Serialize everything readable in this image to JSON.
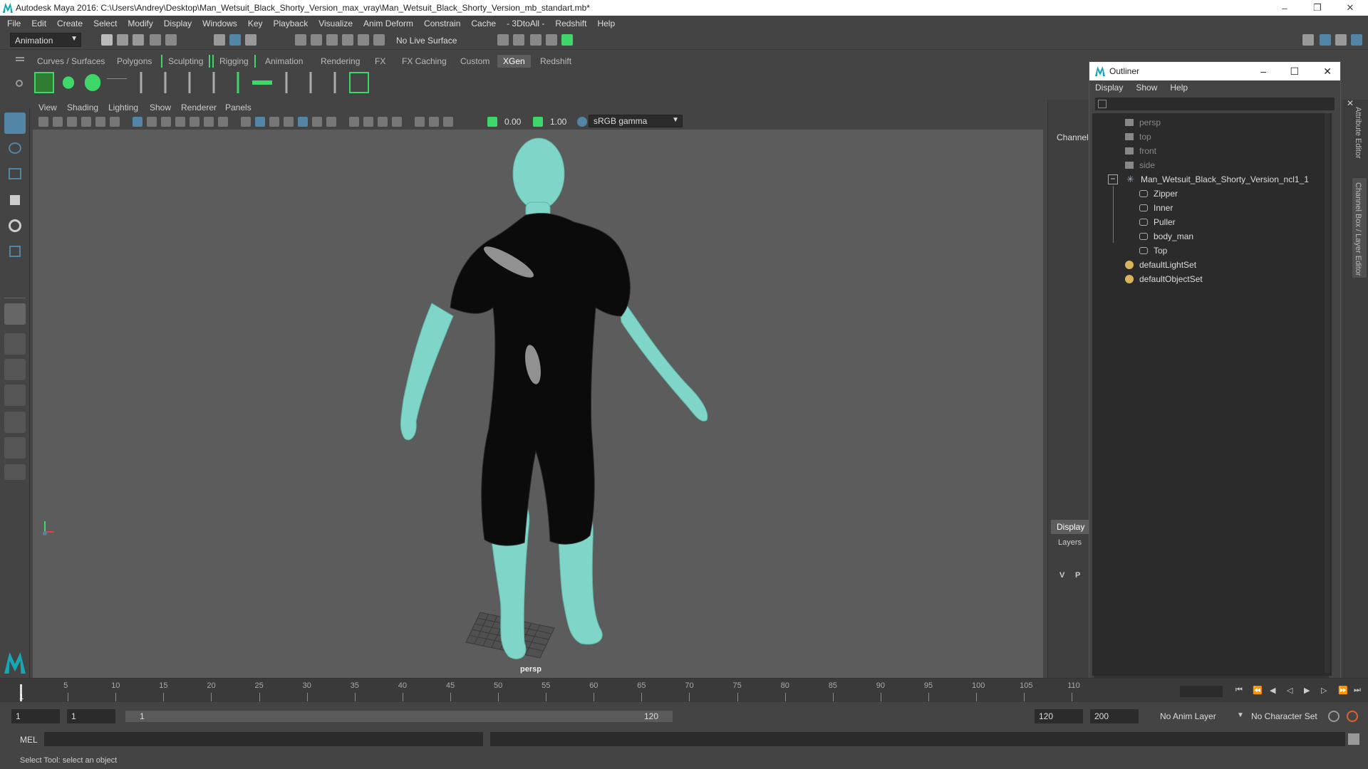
{
  "window": {
    "title": "Autodesk Maya 2016: C:\\Users\\Andrey\\Desktop\\Man_Wetsuit_Black_Shorty_Version_max_vray\\Man_Wetsuit_Black_Shorty_Version_mb_standart.mb*",
    "minimize": "–",
    "restore": "❐",
    "close": "✕"
  },
  "menubar": [
    "File",
    "Edit",
    "Create",
    "Select",
    "Modify",
    "Display",
    "Windows",
    "Key",
    "Playback",
    "Visualize",
    "Anim Deform",
    "Constrain",
    "Cache",
    "- 3DtoAll -",
    "Redshift",
    "Help"
  ],
  "statusline": {
    "menuset": "Animation",
    "live_surface": "No Live Surface"
  },
  "shelf_tabs": [
    "Curves / Surfaces",
    "Polygons",
    "Sculpting",
    "Rigging",
    "Animation",
    "Rendering",
    "FX",
    "FX Caching",
    "Custom",
    "XGen",
    "Redshift"
  ],
  "shelf_active_tab": "XGen",
  "viewport": {
    "menu": [
      "View",
      "Shading",
      "Lighting",
      "Show",
      "Renderer",
      "Panels"
    ],
    "exposure": "0.00",
    "gamma": "1.00",
    "colorspace": "sRGB gamma",
    "camera_label": "persp"
  },
  "channels": {
    "title": "Channels",
    "display_tab": "Display",
    "layers": "Layers",
    "v": "V",
    "p": "P"
  },
  "outliner": {
    "title": "Outliner",
    "minimize": "–",
    "maximize": "☐",
    "close": "✕",
    "menu": [
      "Display",
      "Show",
      "Help"
    ],
    "items": {
      "persp": "persp",
      "top": "top",
      "front": "front",
      "side": "side",
      "root": "Man_Wetsuit_Black_Shorty_Version_ncl1_1",
      "zipper": "Zipper",
      "inner": "Inner",
      "puller": "Puller",
      "body_man": "body_man",
      "top_mesh": "Top",
      "lightset": "defaultLightSet",
      "objectset": "defaultObjectSet"
    },
    "collapse": "−"
  },
  "side_tabs": {
    "attribute_editor": "Attribute Editor",
    "channel_box": "Channel Box / Layer Editor"
  },
  "timeline": {
    "ticks": [
      "5",
      "10",
      "15",
      "20",
      "25",
      "30",
      "35",
      "40",
      "45",
      "50",
      "55",
      "60",
      "65",
      "70",
      "75",
      "80",
      "85",
      "90",
      "95",
      "100",
      "105",
      "110"
    ],
    "current": "1"
  },
  "range": {
    "start": "1",
    "playback_start": "1",
    "slider_start": "1",
    "slider_end": "120",
    "playback_end": "120",
    "end": "200",
    "anim_layer": "No Anim Layer",
    "char_set": "No Character Set"
  },
  "cmdline": {
    "lang": "MEL"
  },
  "help": "Select Tool: select an object",
  "colors": {
    "skin": "#7fd6c8",
    "suit": "#0b0b0b",
    "accent": "#5285a6",
    "shelf_green": "#3fd76a"
  }
}
